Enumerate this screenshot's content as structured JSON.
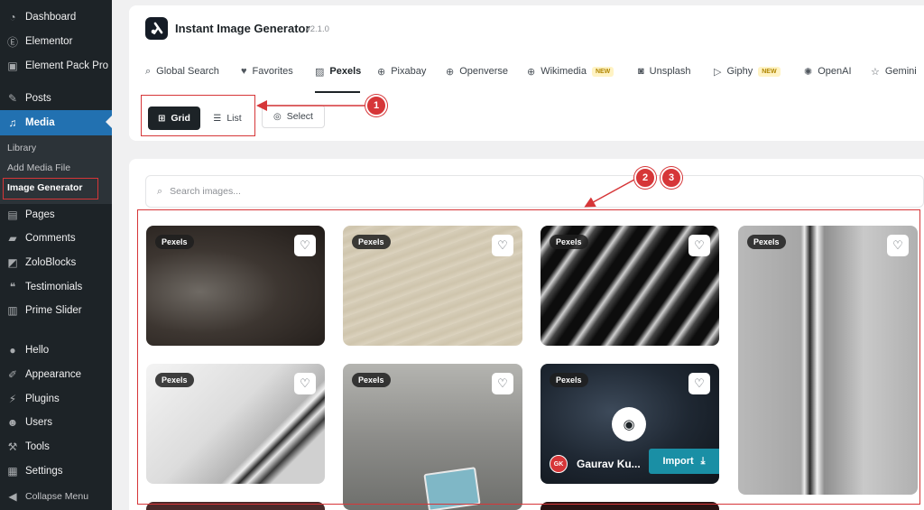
{
  "sidebar": {
    "items": [
      {
        "label": "Dashboard",
        "icon": "dashboard-icon"
      },
      {
        "label": "Elementor",
        "icon": "elementor-icon"
      },
      {
        "label": "Element Pack Pro",
        "icon": "element-pack-icon"
      },
      {
        "label": "Posts",
        "icon": "pin-icon"
      },
      {
        "label": "Media",
        "icon": "media-icon"
      },
      {
        "label": "Pages",
        "icon": "page-icon"
      },
      {
        "label": "Comments",
        "icon": "comment-icon"
      },
      {
        "label": "ZoloBlocks",
        "icon": "zoloblocks-icon"
      },
      {
        "label": "Testimonials",
        "icon": "testimonials-icon"
      },
      {
        "label": "Prime Slider",
        "icon": "slider-icon"
      },
      {
        "label": "Hello",
        "icon": "hello-icon"
      },
      {
        "label": "Appearance",
        "icon": "brush-icon"
      },
      {
        "label": "Plugins",
        "icon": "plugin-icon"
      },
      {
        "label": "Users",
        "icon": "user-icon"
      },
      {
        "label": "Tools",
        "icon": "wrench-icon"
      },
      {
        "label": "Settings",
        "icon": "settings-icon"
      },
      {
        "label": "Collapse Menu",
        "icon": "collapse-icon"
      }
    ],
    "submenu": {
      "library": "Library",
      "add_media": "Add Media File",
      "image_generator": "Image Generator"
    }
  },
  "header": {
    "app_title": "Instant Image Generator",
    "version": "v2.1.0",
    "tabs": [
      {
        "label": "Global Search",
        "icon": "search-icon"
      },
      {
        "label": "Favorites",
        "icon": "heart-icon"
      },
      {
        "label": "Pexels",
        "icon": "image-icon"
      },
      {
        "label": "Pixabay",
        "icon": "globe-icon"
      },
      {
        "label": "Openverse",
        "icon": "globe-icon"
      },
      {
        "label": "Wikimedia",
        "icon": "globe-icon",
        "badge": "NEW"
      },
      {
        "label": "Unsplash",
        "icon": "camera-icon"
      },
      {
        "label": "Giphy",
        "icon": "play-icon",
        "badge": "NEW"
      },
      {
        "label": "OpenAI",
        "icon": "sparkle-icon"
      },
      {
        "label": "Gemini",
        "icon": "star-icon"
      }
    ],
    "view": {
      "grid": "Grid",
      "list": "List",
      "select": "Select"
    }
  },
  "content": {
    "search_placeholder": "Search images...",
    "source_badge": "Pexels",
    "featured_card": {
      "author_initials": "GK",
      "author_name": "Gaurav Ku...",
      "import_label": "Import"
    }
  },
  "annotations": {
    "n1": "1",
    "n2": "2",
    "n3": "3"
  },
  "colors": {
    "sidebar_bg": "#1d2327",
    "active_blue": "#2271b1",
    "annotation_red": "#d63638",
    "import_teal": "#1a8fa5"
  }
}
